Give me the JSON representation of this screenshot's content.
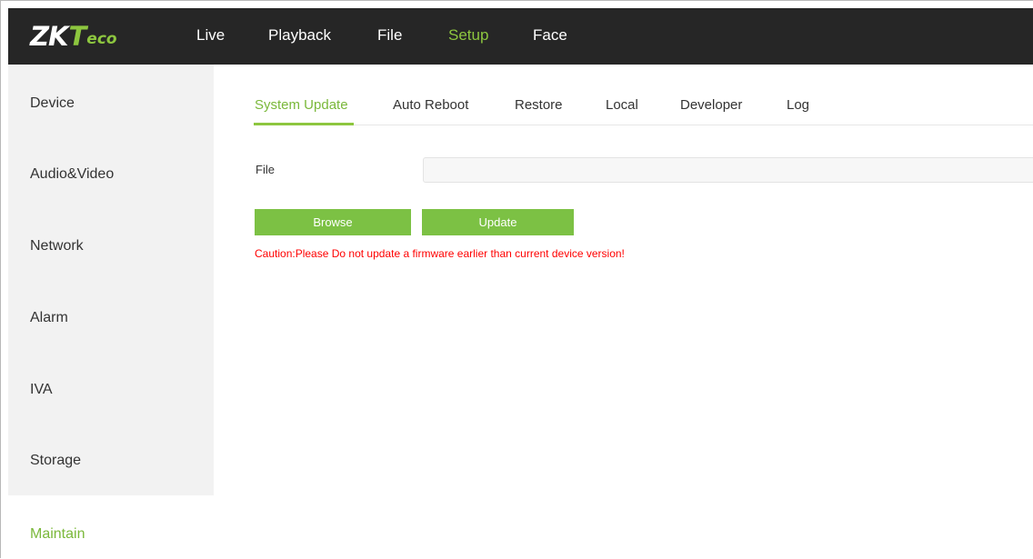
{
  "brand": {
    "logo_zk": "ZK",
    "logo_t": "T",
    "logo_eco": "eco"
  },
  "nav": {
    "items": [
      {
        "label": "Live"
      },
      {
        "label": "Playback"
      },
      {
        "label": "File"
      },
      {
        "label": "Setup",
        "active": true
      },
      {
        "label": "Face"
      }
    ]
  },
  "sidebar": {
    "items": [
      {
        "label": "Device"
      },
      {
        "label": "Audio&Video"
      },
      {
        "label": "Network"
      },
      {
        "label": "Alarm"
      },
      {
        "label": "IVA"
      },
      {
        "label": "Storage"
      },
      {
        "label": "Maintain",
        "active": true
      }
    ]
  },
  "tabs": {
    "items": [
      {
        "label": "System Update",
        "active": true
      },
      {
        "label": "Auto Reboot"
      },
      {
        "label": "Restore"
      },
      {
        "label": "Local"
      },
      {
        "label": "Developer"
      },
      {
        "label": "Log"
      }
    ]
  },
  "form": {
    "file_label": "File",
    "file_value": "",
    "browse_label": "Browse",
    "update_label": "Update",
    "caution_text": "Caution:Please Do not update a firmware earlier than current device version!"
  },
  "colors": {
    "accent": "#8dc63f",
    "topbar_bg": "#262626",
    "sidebar_bg": "#f2f2f2",
    "button_bg": "#7cc144",
    "caution": "#ff0000"
  }
}
